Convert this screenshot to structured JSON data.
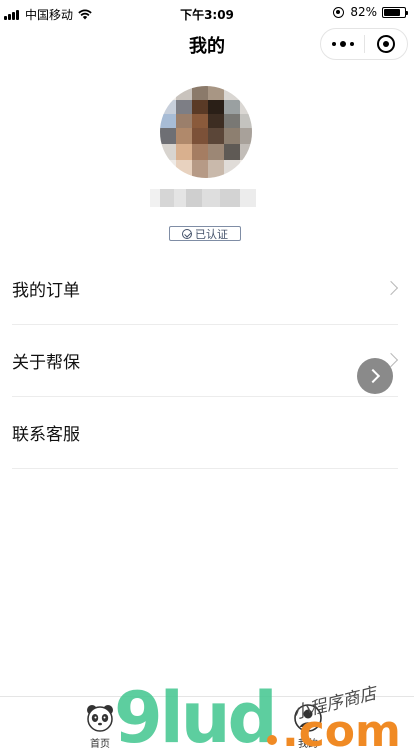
{
  "status_bar": {
    "carrier": "中国移动",
    "time": "下午3:09",
    "battery_percent": "82%",
    "battery_level": 0.82
  },
  "nav": {
    "title": "我的"
  },
  "profile": {
    "verified_label": "已认证"
  },
  "menu": [
    {
      "label": "我的订单"
    },
    {
      "label": "关于帮保"
    },
    {
      "label": "联系客服"
    }
  ],
  "tab_bar": {
    "items": [
      {
        "label": "首页"
      },
      {
        "label": "我的"
      }
    ]
  },
  "watermark": {
    "logo_text": "9lud",
    "domain_text": ".com",
    "handwriting": "小程序商店"
  },
  "colors": {
    "badge_border": "#7f8da5",
    "badge_text": "#44526a",
    "watermark_green": "#4cc995",
    "watermark_orange": "#f08a24",
    "float_button": "#8a8a8a"
  }
}
